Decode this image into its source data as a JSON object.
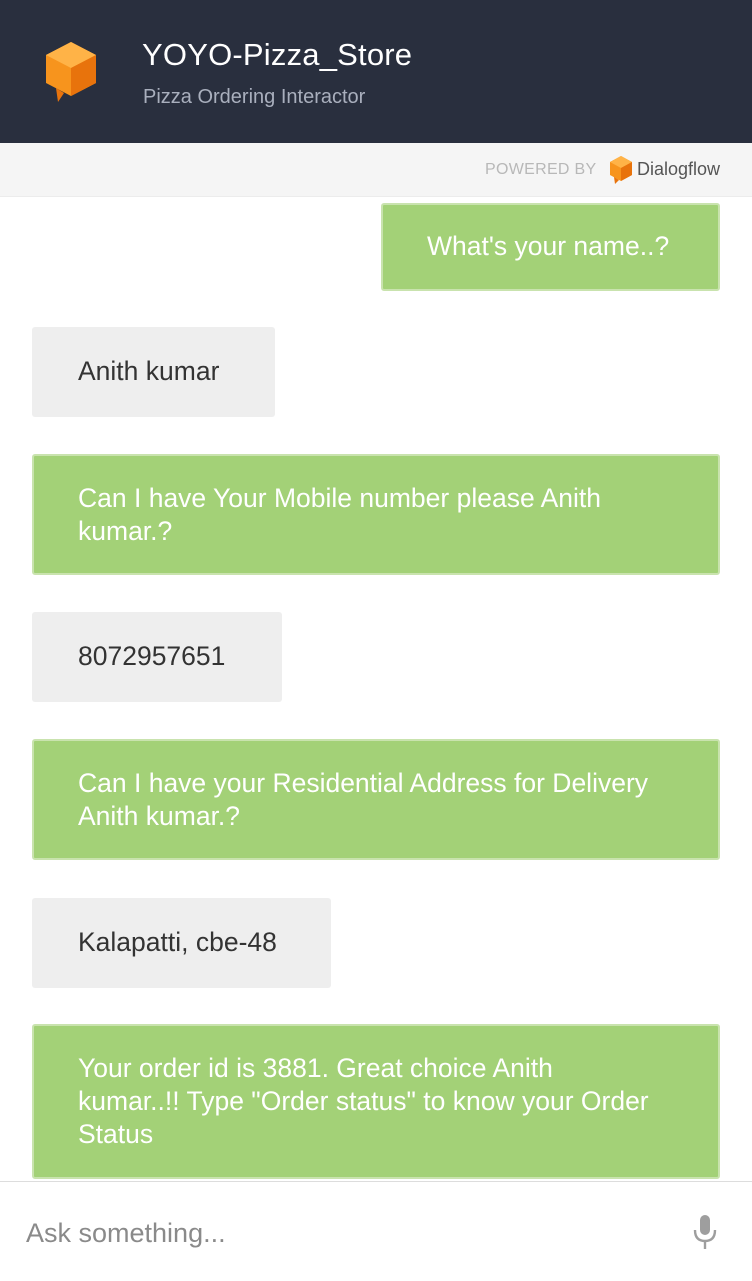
{
  "header": {
    "title": "YOYO-Pizza_Store",
    "subtitle": "Pizza Ordering Interactor",
    "logo_icon": "orange-cube-speech-icon"
  },
  "powered": {
    "label": "POWERED BY",
    "brand": "Dialogflow",
    "brand_icon": "dialogflow-cube-icon"
  },
  "messages": [
    {
      "sender": "bot",
      "lines": [
        "What's your name..?"
      ]
    },
    {
      "sender": "user",
      "lines": [
        "Anith kumar"
      ]
    },
    {
      "sender": "bot",
      "lines": [
        "Can I have Your Mobile number please Anith",
        "kumar.?"
      ]
    },
    {
      "sender": "user",
      "lines": [
        "8072957651"
      ]
    },
    {
      "sender": "bot",
      "lines": [
        "Can I have your Residential Address for Delivery",
        "Anith kumar.?"
      ]
    },
    {
      "sender": "user",
      "lines": [
        "Kalapatti, cbe-48"
      ]
    },
    {
      "sender": "bot",
      "lines": [
        "Your order id is 3881. Great choice Anith",
        "kumar..!! Type \"Order status\" to know your Order",
        "Status"
      ]
    }
  ],
  "input": {
    "placeholder": "Ask something...",
    "value": "",
    "mic_icon": "microphone-icon"
  },
  "colors": {
    "header_bg": "#292f3e",
    "bot_bubble": "#a3d177",
    "user_bubble": "#eeeeee",
    "brand_orange": "#f57c00"
  }
}
